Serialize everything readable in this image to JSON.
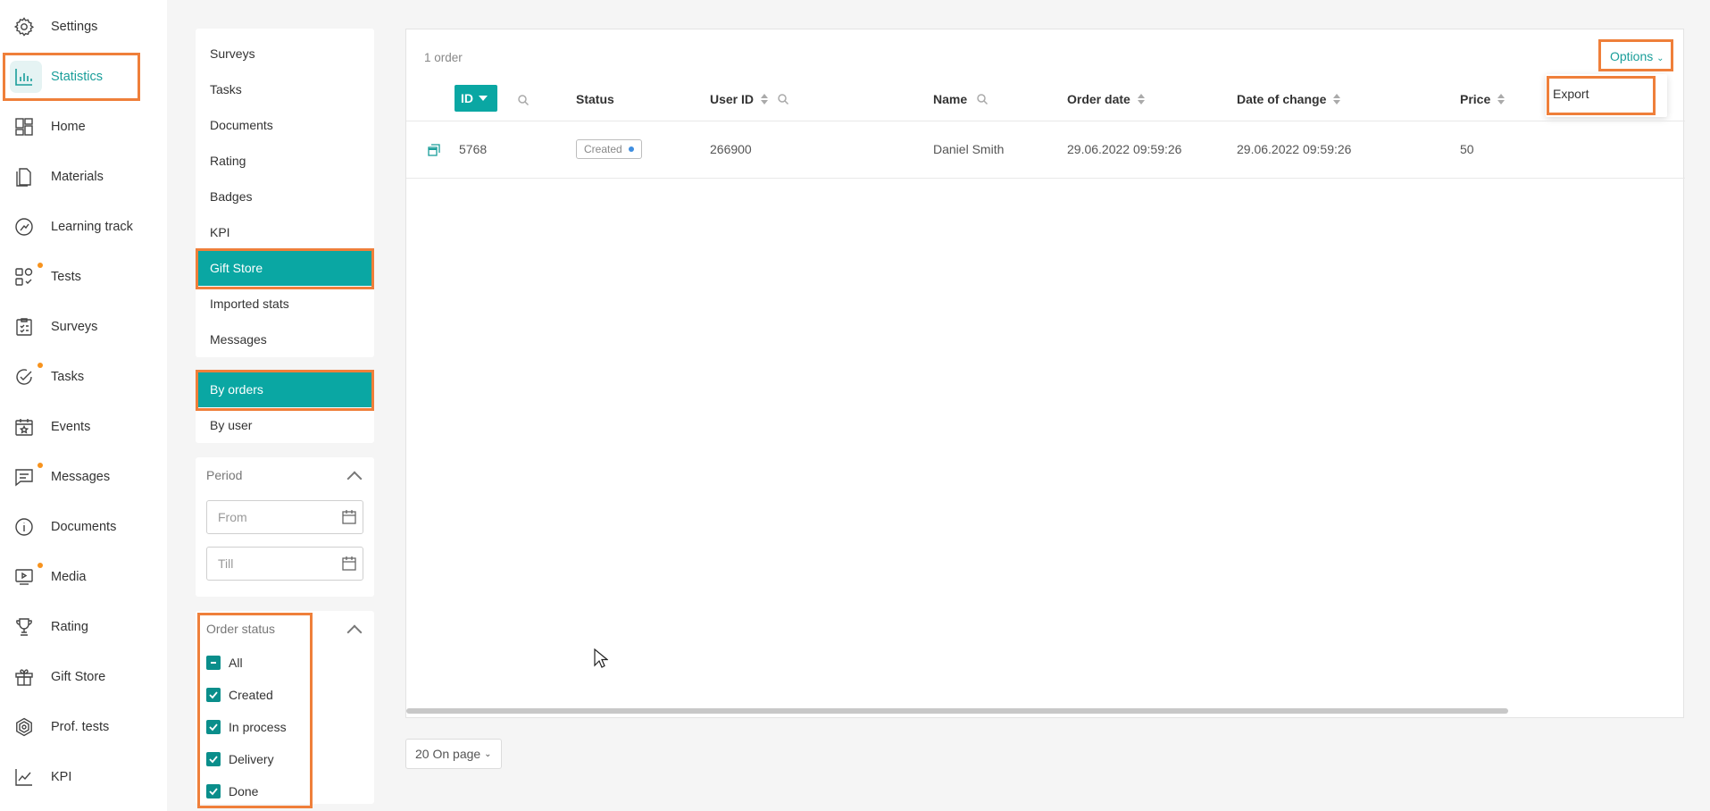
{
  "nav": {
    "items": [
      {
        "label": "Settings",
        "icon": "gear-icon",
        "dot": false
      },
      {
        "label": "Statistics",
        "icon": "bar-chart-icon",
        "dot": false,
        "active": true
      },
      {
        "label": "Home",
        "icon": "dashboard-icon",
        "dot": false
      },
      {
        "label": "Materials",
        "icon": "document-icon",
        "dot": false
      },
      {
        "label": "Learning track",
        "icon": "track-icon",
        "dot": false
      },
      {
        "label": "Tests",
        "icon": "tests-icon",
        "dot": true
      },
      {
        "label": "Surveys",
        "icon": "clipboard-icon",
        "dot": false
      },
      {
        "label": "Tasks",
        "icon": "check-circle-icon",
        "dot": true
      },
      {
        "label": "Events",
        "icon": "calendar-star-icon",
        "dot": false
      },
      {
        "label": "Messages",
        "icon": "message-icon",
        "dot": true
      },
      {
        "label": "Documents",
        "icon": "info-circle-icon",
        "dot": false
      },
      {
        "label": "Media",
        "icon": "media-icon",
        "dot": true
      },
      {
        "label": "Rating",
        "icon": "trophy-icon",
        "dot": false
      },
      {
        "label": "Gift Store",
        "icon": "gift-icon",
        "dot": false
      },
      {
        "label": "Prof. tests",
        "icon": "hexagon-icon",
        "dot": false
      },
      {
        "label": "KPI",
        "icon": "line-chart-icon",
        "dot": false
      }
    ]
  },
  "sections": {
    "items": [
      "Surveys",
      "Tasks",
      "Documents",
      "Rating",
      "Badges",
      "KPI",
      "Gift Store",
      "Imported stats",
      "Messages"
    ],
    "selected": "Gift Store"
  },
  "views": {
    "items": [
      "By orders",
      "By user"
    ],
    "selected": "By orders"
  },
  "period": {
    "title": "Period",
    "from_placeholder": "From",
    "till_placeholder": "Till"
  },
  "order_status": {
    "title": "Order status",
    "options": [
      "All",
      "Created",
      "In process",
      "Delivery",
      "Done"
    ]
  },
  "table": {
    "count": "1 order",
    "options_label": "Options",
    "options_menu": [
      "Export"
    ],
    "columns": [
      "ID",
      "Status",
      "User ID",
      "Name",
      "Order date",
      "Date of change",
      "Price"
    ],
    "rows": [
      {
        "id": "5768",
        "status": "Created",
        "user_id": "266900",
        "name": "Daniel Smith",
        "order_date": "29.06.2022 09:59:26",
        "date_of_change": "29.06.2022 09:59:26",
        "price": "50"
      }
    ]
  },
  "pagination": {
    "per_page": "20 On page"
  },
  "colors": {
    "accent": "#0aa7a3",
    "highlight": "#ef7f3a",
    "status_dot": "#3f8ee0"
  }
}
